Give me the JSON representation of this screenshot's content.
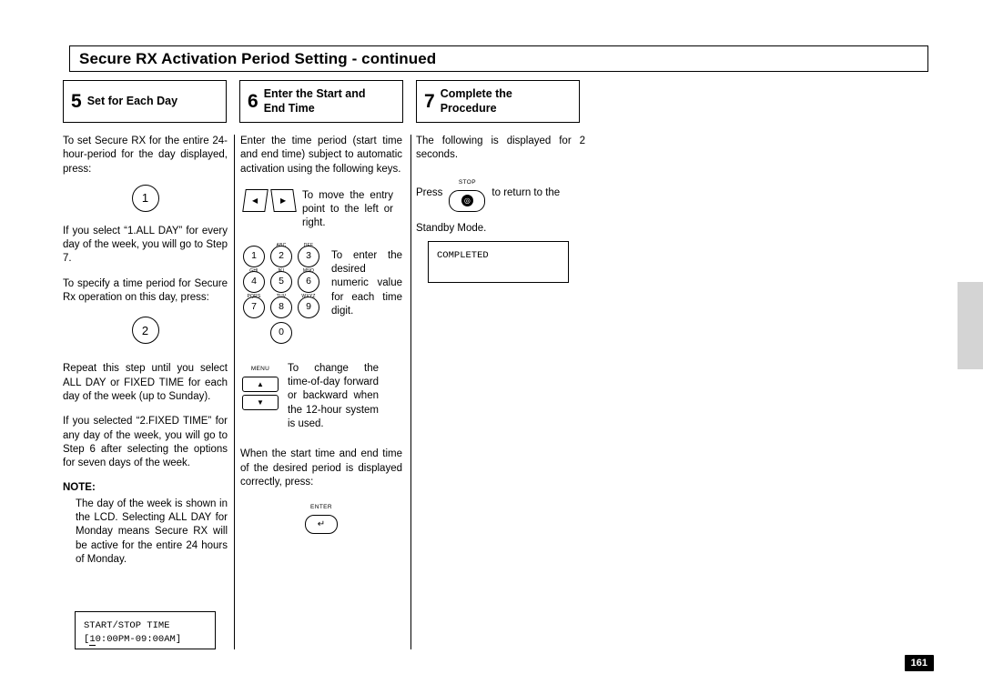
{
  "header": {
    "title": "Secure RX Activation Period Setting - continued"
  },
  "steps": [
    {
      "number": "5",
      "label": "Set for Each Day"
    },
    {
      "number": "6",
      "label_line1": "Enter the Start and",
      "label_line2": "End Time"
    },
    {
      "number": "7",
      "label_line1": "Complete the",
      "label_line2": "Procedure"
    }
  ],
  "column1": {
    "p1": "To set Secure RX for the entire 24-hour-period for the day displayed, press:",
    "key1": "1",
    "p2": "If you select “1.ALL DAY” for every day of the week, you will go to Step 7.",
    "p3": "To specify a time period for Secure Rx operation on this day, press:",
    "key2": "2",
    "p4": "Repeat this step until you select ALL DAY or FIXED TIME for each day of the week (up to Sunday).",
    "p5": "If you selected “2.FIXED TIME” for any day of the week, you will go to Step 6 after selecting the options for seven days of the week.",
    "note_title": "NOTE",
    "note_colon": ":",
    "note_body": "The day of the week is shown in the LCD. Selecting ALL DAY for Monday means Secure RX will be active for the entire 24 hours of Monday.",
    "lcd_line1": "START/STOP TIME",
    "lcd_line2_prefix": "[",
    "lcd_line2_underlined": "1",
    "lcd_line2_rest": "0:00PM-09:00AM]"
  },
  "column2": {
    "p1": "Enter the time period (start time and end time) subject to automatic activation using the following keys.",
    "arrow_text": "To move the entry point to the left or right.",
    "arrow_left_glyph": "◀",
    "arrow_right_glyph": "▶",
    "keypad_text": "To enter the desired numeric value for each time digit.",
    "keypad": [
      {
        "digit": "1",
        "sub": ""
      },
      {
        "digit": "2",
        "sub": "ABC"
      },
      {
        "digit": "3",
        "sub": "DEF"
      },
      {
        "digit": "4",
        "sub": "GHI"
      },
      {
        "digit": "5",
        "sub": "JKL"
      },
      {
        "digit": "6",
        "sub": "MNO"
      },
      {
        "digit": "7",
        "sub": "PQRS"
      },
      {
        "digit": "8",
        "sub": "TUV"
      },
      {
        "digit": "9",
        "sub": "WXYZ"
      },
      {
        "digit": "0",
        "sub": ""
      }
    ],
    "menu_label": "MENU",
    "menu_up_glyph": "▲",
    "menu_down_glyph": "▼",
    "menu_text": "To change the time-of-day forward or backward when the 12-hour system is used.",
    "p_end": "When the start time and end time of the desired period is displayed correctly, press:",
    "enter_label": "ENTER",
    "enter_glyph": "↵"
  },
  "column3": {
    "p1": "The following is displayed for 2 seconds.",
    "press_word": "Press",
    "stop_label": "STOP",
    "stop_glyph": "◎",
    "after_key_text": "to return to the",
    "p2": "Standby Mode.",
    "lcd_line1": "COMPLETED"
  },
  "footer": {
    "page_number": "161"
  },
  "colors": {
    "side_tab": "#d4d4d4",
    "page_number_bg": "#000000",
    "text": "#000000"
  }
}
